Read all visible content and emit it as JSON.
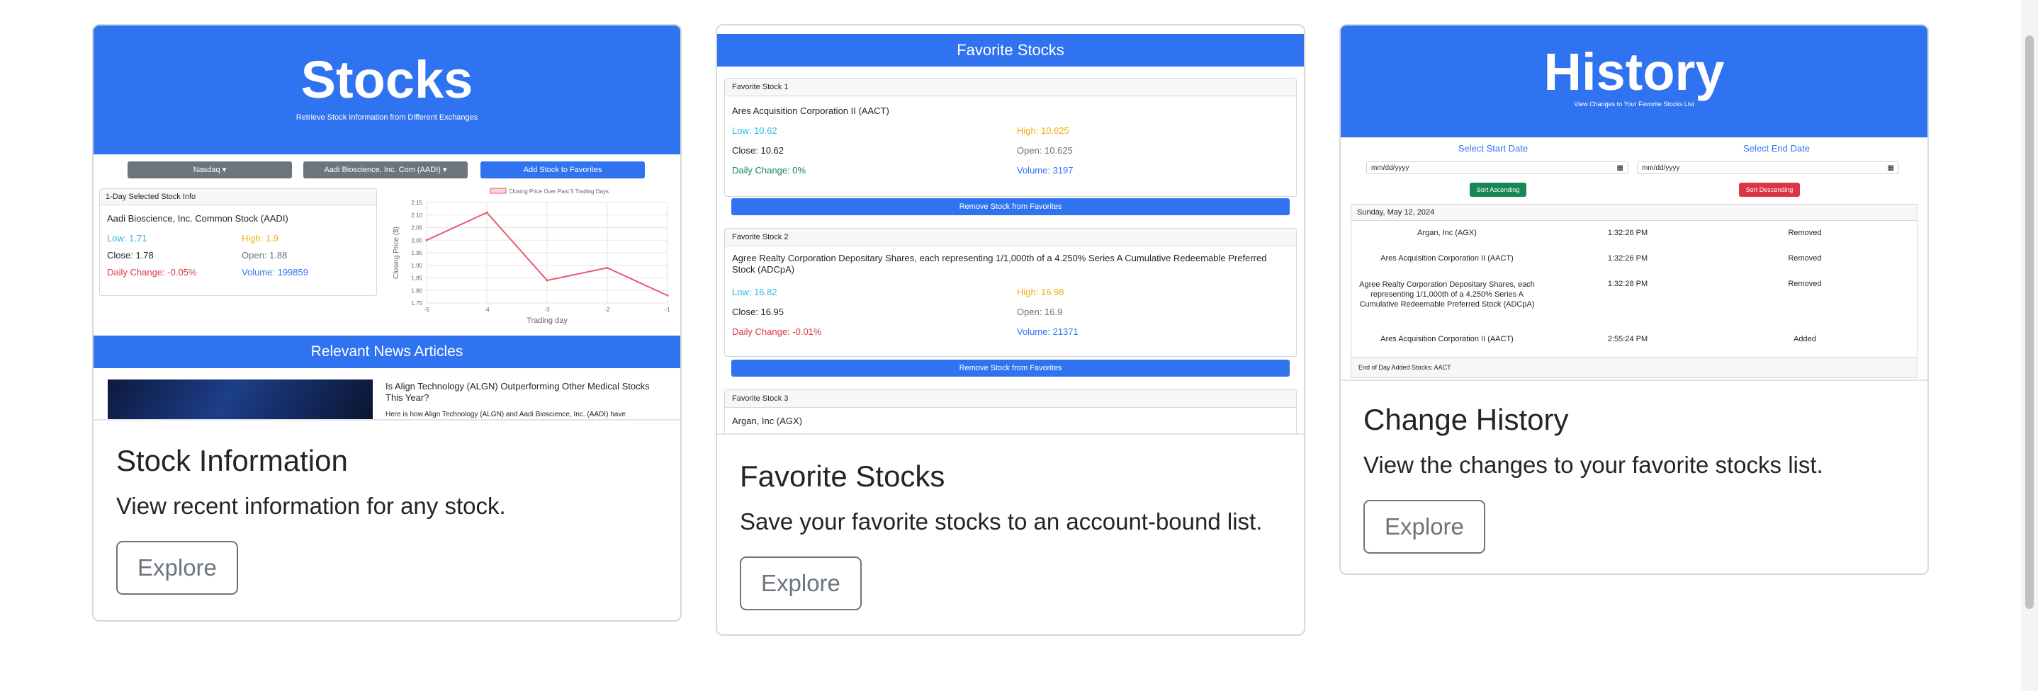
{
  "cards": [
    {
      "title": "Stock Information",
      "text": "View recent information for any stock.",
      "button": "Explore",
      "preview": {
        "header_title": "Stocks",
        "header_subtitle": "Retrieve Stock Information from Different Exchanges",
        "exchange_dropdown": "Nasdaq",
        "stock_dropdown": "Aadi Bioscience, Inc. Com (AADI)",
        "add_button": "Add Stock to Favorites",
        "info_card_header": "1-Day Selected Stock Info",
        "stock_name": "Aadi Bioscience, Inc. Common Stock (AADI)",
        "low": "Low: 1.71",
        "high": "High: 1.9",
        "close": "Close: 1.78",
        "open": "Open: 1.88",
        "daily_change": "Daily Change: -0.05%",
        "volume": "Volume: 199859",
        "news_header": "Relevant News Articles",
        "news_title": "Is Align Technology (ALGN) Outperforming Other Medical Stocks This Year?",
        "news_snippet": "Here is how Align Technology (ALGN) and Aadi Bioscience, Inc. (AADI) have"
      }
    },
    {
      "title": "Favorite Stocks",
      "text": "Save your favorite stocks to an account-bound list.",
      "button": "Explore",
      "preview": {
        "header_title": "Favorite Stocks",
        "remove_button": "Remove Stock from Favorites",
        "favorites": [
          {
            "head": "Favorite Stock 1",
            "name": "Ares Acquisition Corporation II (AACT)",
            "low": "Low: 10.62",
            "high": "High: 10.625",
            "close": "Close: 10.62",
            "open": "Open: 10.625",
            "daily_change": "Daily Change: 0%",
            "volume": "Volume: 3197"
          },
          {
            "head": "Favorite Stock 2",
            "name": "Agree Realty Corporation Depositary Shares, each representing 1/1,000th of a 4.250% Series A Cumulative Redeemable Preferred Stock (ADCpA)",
            "low": "Low: 16.82",
            "high": "High: 16.98",
            "close": "Close: 16.95",
            "open": "Open: 16.9",
            "daily_change": "Daily Change: -0.01%",
            "volume": "Volume: 21371"
          },
          {
            "head": "Favorite Stock 3",
            "name": "Argan, Inc (AGX)"
          }
        ]
      }
    },
    {
      "title": "Change History",
      "text": "View the changes to your favorite stocks list.",
      "button": "Explore",
      "preview": {
        "header_title": "History",
        "header_subtitle": "View Changes to Your Favorite Stocks List",
        "start_label": "Select Start Date",
        "end_label": "Select End Date",
        "date_placeholder": "mm/dd/yyyy",
        "sort_asc": "Sort Ascending",
        "sort_desc": "Sort Descending",
        "day_header": "Sunday, May 12, 2024",
        "rows": [
          {
            "name": "Argan, Inc (AGX)",
            "time": "1:32:26 PM",
            "action": "Removed"
          },
          {
            "name": "Ares Acquisition Corporation II (AACT)",
            "time": "1:32:26 PM",
            "action": "Removed"
          },
          {
            "name": "Agree Realty Corporation Depositary Shares, each representing 1/1,000th of a 4.250% Series A Cumulative Redeemable Preferred Stock (ADCpA)",
            "time": "1:32:28 PM",
            "action": "Removed"
          },
          {
            "name": "Ares Acquisition Corporation II (AACT)",
            "time": "2:55:24 PM",
            "action": "Added"
          }
        ],
        "footer": "End of Day Added Stocks: AACT"
      }
    }
  ],
  "chart_data": {
    "type": "line",
    "legend": "Closing Price Over Past 5 Trading Days",
    "xlabel": "Trading day",
    "ylabel": "Closing Price ($)",
    "x": [
      -5,
      -4,
      -3,
      -2,
      -1
    ],
    "x_ticks": [
      "-5",
      "-4",
      "-3",
      "-2",
      "-1"
    ],
    "y_ticks": [
      "1.75",
      "1.80",
      "1.85",
      "1.90",
      "1.95",
      "2.00",
      "2.05",
      "2.10",
      "2.15"
    ],
    "ylim": [
      1.75,
      2.15
    ],
    "series": [
      {
        "name": "Closing Price Over Past 5 Trading Days",
        "values": [
          2.0,
          2.11,
          1.84,
          1.89,
          1.78
        ]
      }
    ],
    "color": "#e8596f",
    "grid": true,
    "legend_position": "top"
  },
  "colors": {
    "brand_blue": "#3073f1",
    "low": "#2eb7e8",
    "high": "#f0ad12",
    "negative": "#dc3545",
    "positive": "#198754",
    "secondary": "#6c757d"
  }
}
